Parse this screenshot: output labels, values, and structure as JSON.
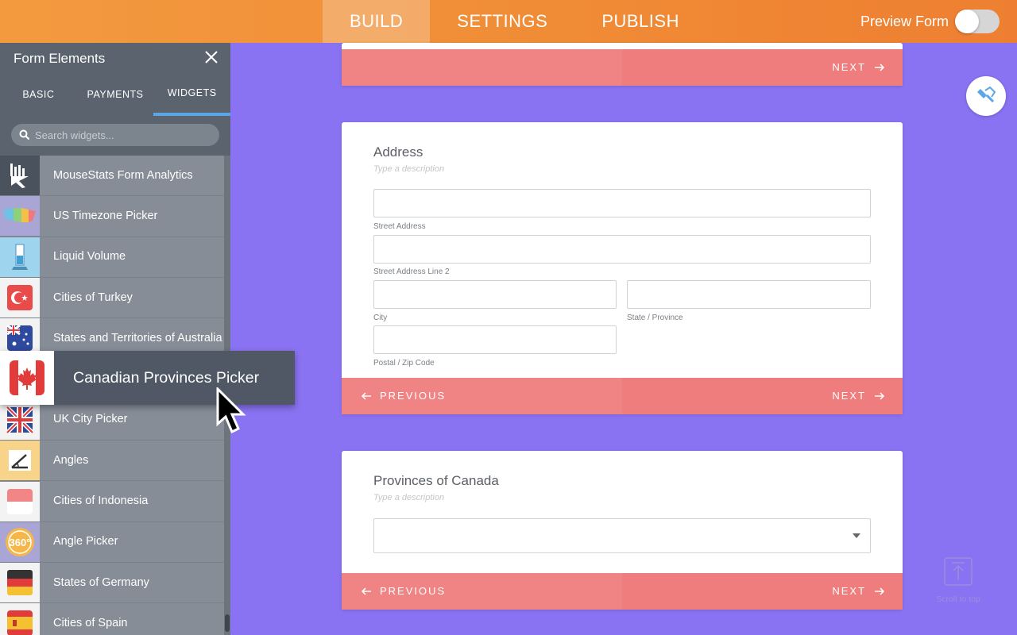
{
  "topbar": {
    "tabs": [
      "BUILD",
      "SETTINGS",
      "PUBLISH"
    ],
    "preview_label": "Preview Form"
  },
  "sidebar": {
    "title": "Form Elements",
    "tabs": [
      "BASIC",
      "PAYMENTS",
      "WIDGETS"
    ],
    "active_tab": "WIDGETS",
    "search_placeholder": "Search widgets...",
    "widgets": [
      {
        "label": "MouseStats Form Analytics",
        "icon": "mousestats-icon"
      },
      {
        "label": "US Timezone Picker",
        "icon": "us-map-icon"
      },
      {
        "label": "Liquid Volume",
        "icon": "beaker-icon"
      },
      {
        "label": "Cities of Turkey",
        "icon": "turkey-flag-icon"
      },
      {
        "label": "States and Territories of Australia",
        "icon": "australia-flag-icon"
      },
      {
        "label": "",
        "icon": "hidden"
      },
      {
        "label": "UK City Picker",
        "icon": "uk-flag-icon"
      },
      {
        "label": "Angles",
        "icon": "angle-icon"
      },
      {
        "label": "Cities of Indonesia",
        "icon": "indonesia-flag-icon"
      },
      {
        "label": "Angle Picker",
        "icon": "360-icon"
      },
      {
        "label": "States of Germany",
        "icon": "germany-flag-icon"
      },
      {
        "label": "Cities of Spain",
        "icon": "spain-flag-icon"
      }
    ]
  },
  "dragged_widget": {
    "label": "Canadian Provinces Picker",
    "icon": "canada-flag-icon"
  },
  "card1": {
    "next": "NEXT"
  },
  "card2": {
    "title": "Address",
    "description": "Type a description",
    "fields": {
      "street": "Street Address",
      "street2": "Street Address Line 2",
      "city": "City",
      "state": "State / Province",
      "zip": "Postal / Zip Code"
    },
    "previous": "PREVIOUS",
    "next": "NEXT"
  },
  "card3": {
    "title": "Provinces of Canada",
    "description": "Type a description",
    "previous": "PREVIOUS",
    "next": "NEXT"
  },
  "scroll_to_top": "Scroll to top",
  "colors": {
    "accent": "#f08a35",
    "background": "#8a73f2",
    "nav_bar": "#f07f7f",
    "sidebar": "#868d97"
  }
}
